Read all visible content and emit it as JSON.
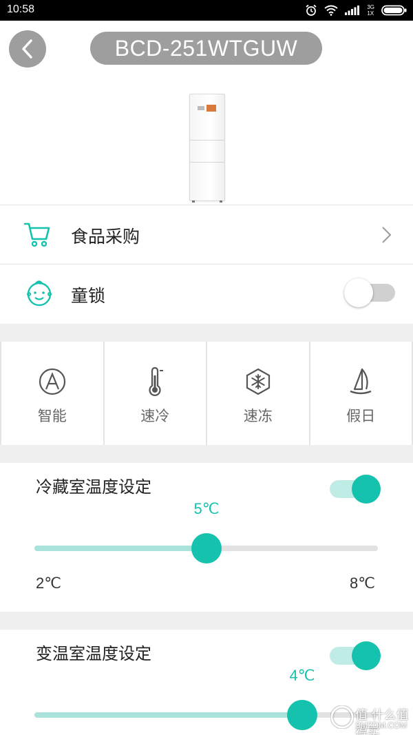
{
  "status_bar": {
    "time": "10:58",
    "network_top": "3G",
    "network_bottom": "1X",
    "icons": [
      "alarm-icon",
      "wifi-icon",
      "signal-icon",
      "battery-icon"
    ]
  },
  "header": {
    "back_icon": "chevron-left-icon",
    "title": "BCD-251WTGUW"
  },
  "menu": {
    "shopping": {
      "label": "食品采购",
      "icon": "shopping-cart-icon"
    },
    "child_lock": {
      "label": "童锁",
      "icon": "baby-face-icon",
      "enabled": false
    }
  },
  "modes": [
    {
      "label": "智能",
      "icon": "circle-a-icon"
    },
    {
      "label": "速冷",
      "icon": "thermometer-icon"
    },
    {
      "label": "速冻",
      "icon": "snowflake-hex-icon"
    },
    {
      "label": "假日",
      "icon": "sailboat-icon"
    }
  ],
  "fridge_section": {
    "title": "冷藏室温度设定",
    "enabled": true,
    "value": 5,
    "value_label": "5℃",
    "min": 2,
    "max": 8,
    "min_label": "2℃",
    "max_label": "8℃"
  },
  "variable_section": {
    "title": "变温室温度设定",
    "enabled": true,
    "value_label": "4℃",
    "value_fraction": 0.78
  },
  "watermark": {
    "line1": "值 什么值得买",
    "line2": "SMZDM.COM"
  },
  "colors": {
    "accent": "#15c2ad",
    "accent_light": "#a9e3dc",
    "pill_gray": "#9e9e9e",
    "divider": "#efefef"
  }
}
